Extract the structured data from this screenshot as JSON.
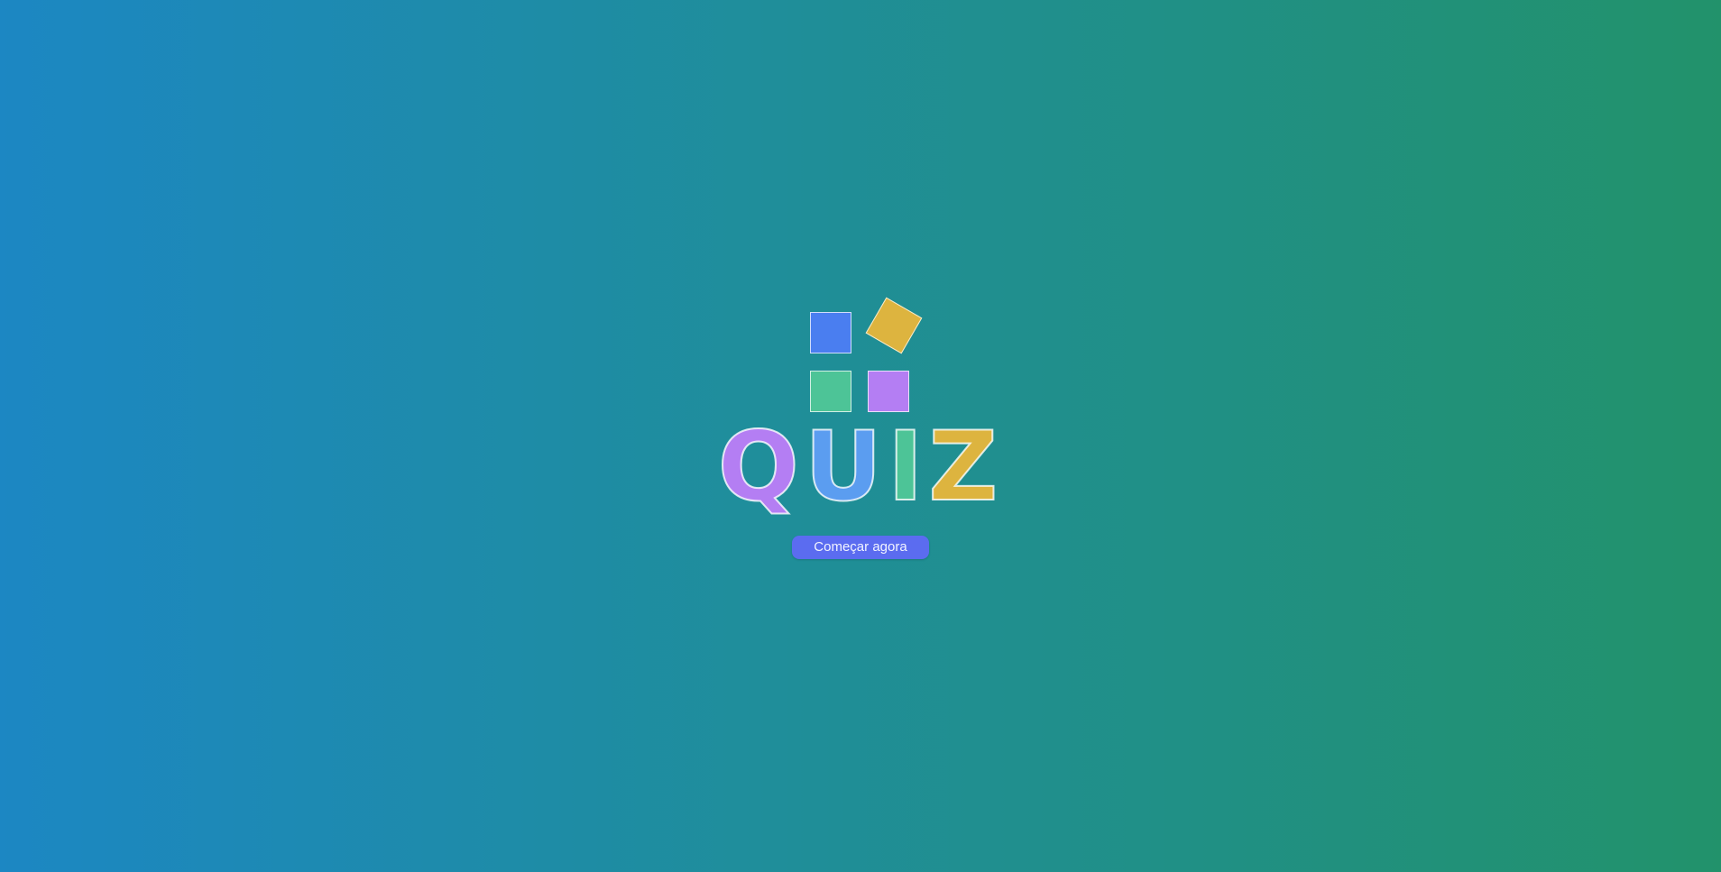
{
  "logo": {
    "icon": "quiz-blocks-logo",
    "squares": [
      {
        "name": "blue-square",
        "color": "#4a7ef0"
      },
      {
        "name": "yellow-square",
        "color": "#ddb43f"
      },
      {
        "name": "green-square",
        "color": "#4dc497"
      },
      {
        "name": "purple-square",
        "color": "#b47ef3"
      }
    ],
    "title_letters": {
      "q": "Q",
      "u": "U",
      "i": "I",
      "z": "Z"
    },
    "title_colors": [
      "#b47ef3",
      "#5b9df0",
      "#4dc497",
      "#ddb43f"
    ]
  },
  "actions": {
    "start_label": "Começar agora",
    "start_color": "#5b6cf0"
  },
  "background": {
    "gradient_start": "#1c87c3",
    "gradient_end": "#22926b"
  }
}
